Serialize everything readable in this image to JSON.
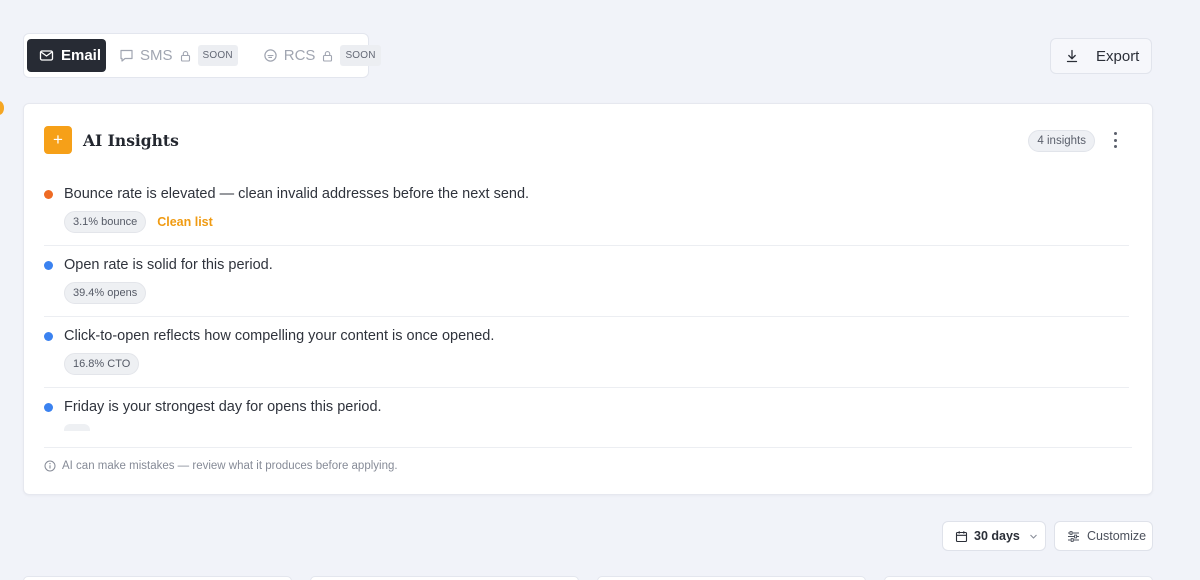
{
  "channels": {
    "tabs": [
      {
        "label": "Email",
        "active": true,
        "icon": "mail-icon"
      },
      {
        "label": "SMS",
        "active": false,
        "icon": "chat-bubble-icon",
        "locked": true,
        "badge": "SOON"
      },
      {
        "label": "RCS",
        "active": false,
        "icon": "rcs-bubble-icon",
        "locked": true,
        "badge": "SOON"
      }
    ]
  },
  "toolbar": {
    "export_label": "Export",
    "export_icon": "download-icon"
  },
  "insights": {
    "title": "AI Insights",
    "count_label": "4 insights",
    "accent_color": "#f6a018",
    "items": [
      {
        "text": "Bounce rate is elevated — clean invalid addresses before the next send.",
        "chip": "3.1% bounce",
        "action": "Clean list",
        "dot_color": "#ee6b24"
      },
      {
        "text": "Open rate is solid for this period.",
        "chip": "39.4% opens",
        "dot_color": "#3b82f0"
      },
      {
        "text": "Click-to-open reflects how compelling your content is once opened.",
        "chip": "16.8% CTO",
        "dot_color": "#3b82f0"
      },
      {
        "text": "Friday is your strongest day for opens this period.",
        "dot_color": "#3b82f0"
      }
    ],
    "disclaimer": "AI can make mistakes — review what it produces before applying."
  },
  "controls": {
    "range_label": "30 days",
    "customize_label": "Customize"
  }
}
